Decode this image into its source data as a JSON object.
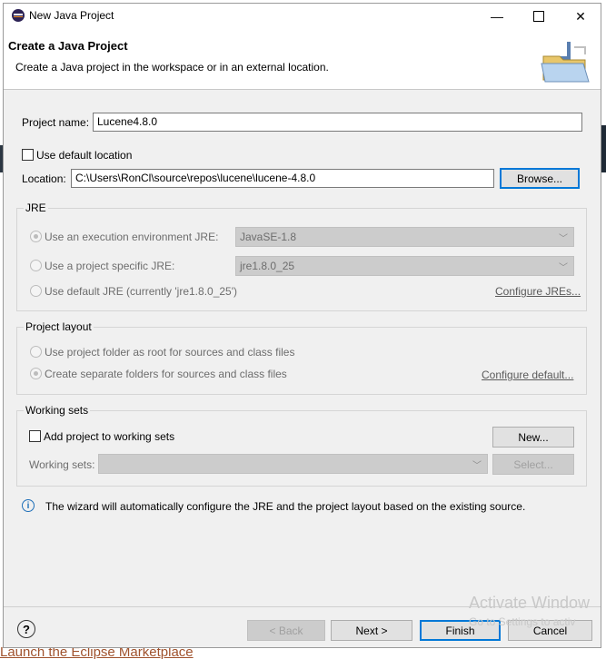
{
  "window": {
    "title": "New Java Project",
    "minimize_glyph": "—",
    "close_glyph": "✕"
  },
  "banner": {
    "title": "Create a Java Project",
    "description": "Create a Java project in the workspace or in an external location."
  },
  "form": {
    "project_name_label": "Project name:",
    "project_name_value": "Lucene4.8.0",
    "use_default_location_label": "Use default location",
    "use_default_location_checked": false,
    "location_label": "Location:",
    "location_value": "C:\\Users\\RonCl\\source\\repos\\lucene\\lucene-4.8.0",
    "browse_label": "Browse..."
  },
  "jre": {
    "group_label": "JRE",
    "option_env_label": "Use an execution environment JRE:",
    "option_env_value": "JavaSE-1.8",
    "option_specific_label": "Use a project specific JRE:",
    "option_specific_value": "jre1.8.0_25",
    "option_default_label": "Use default JRE (currently 'jre1.8.0_25')",
    "configure_link": "Configure JREs...",
    "combo_arrow": "﹀"
  },
  "layout": {
    "group_label": "Project layout",
    "option_root_label": "Use project folder as root for sources and class files",
    "option_separate_label": "Create separate folders for sources and class files",
    "configure_link": "Configure default..."
  },
  "working_sets": {
    "group_label": "Working sets",
    "add_label": "Add project to working sets",
    "new_label": "New...",
    "sets_label": "Working sets:",
    "select_label": "Select..."
  },
  "info": {
    "icon_glyph": "i",
    "message": "The wizard will automatically configure the JRE and the project layout based on the existing source."
  },
  "footer": {
    "help_glyph": "?",
    "back_label": "< Back",
    "next_label": "Next >",
    "finish_label": "Finish",
    "cancel_label": "Cancel"
  },
  "watermark": {
    "line1": "Activate Window",
    "line2": "Go to Settings to activ"
  },
  "backdrop": {
    "link_text": "Launch the Eclipse Marketplace"
  },
  "colors": {
    "accent": "#0078d7",
    "dialog_bg": "#f0f0f0",
    "info_icon": "#1e6fb8"
  }
}
